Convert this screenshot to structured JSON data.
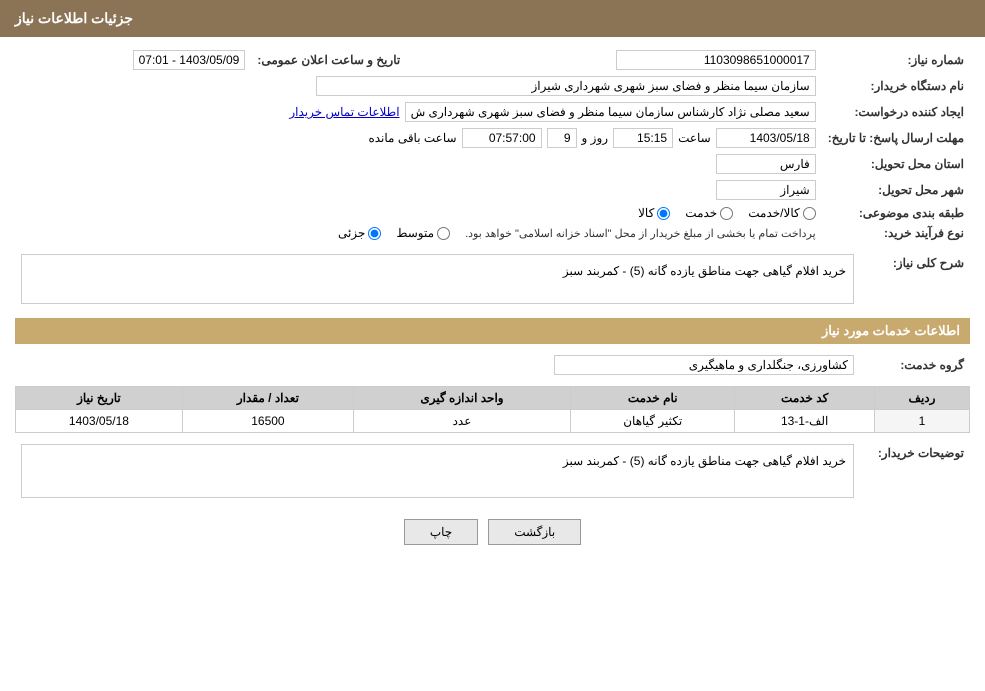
{
  "header": {
    "title": "جزئیات اطلاعات نیاز"
  },
  "info": {
    "need_number_label": "شماره نیاز:",
    "need_number_value": "1103098651000017",
    "announcement_date_label": "تاریخ و ساعت اعلان عمومی:",
    "announcement_date_value": "1403/05/09 - 07:01",
    "buyer_org_label": "نام دستگاه خریدار:",
    "buyer_org_value": "سازمان سیما منظر و فضای سبز شهری شهرداری شیراز",
    "creator_label": "ایجاد کننده درخواست:",
    "creator_value": "سعید مصلی نژاد کارشناس سازمان سیما منظر و فضای سبز شهری شهرداری ش",
    "contact_link": "اطلاعات تماس خریدار",
    "deadline_label": "مهلت ارسال پاسخ: تا تاریخ:",
    "deadline_date_value": "1403/05/18",
    "deadline_time_label": "ساعت",
    "deadline_time_value": "15:15",
    "deadline_days_label": "روز و",
    "deadline_days_value": "9",
    "deadline_remaining_label": "ساعت باقی مانده",
    "deadline_remaining_value": "07:57:00",
    "province_label": "استان محل تحویل:",
    "province_value": "فارس",
    "city_label": "شهر محل تحویل:",
    "city_value": "شیراز",
    "category_label": "طبقه بندی موضوعی:",
    "category_options": [
      "کالا",
      "خدمت",
      "کالا/خدمت"
    ],
    "category_selected": "کالا",
    "process_label": "نوع فرآیند خرید:",
    "process_options": [
      "جزئی",
      "متوسط"
    ],
    "process_note": "پرداخت تمام یا بخشی از مبلغ خریدار از محل \"اسناد خزانه اسلامی\" خواهد بود.",
    "need_desc_label": "شرح کلی نیاز:",
    "need_desc_value": "خرید افلام گیاهی جهت مناطق یازده گانه (5) - کمربند سبز",
    "services_section_title": "اطلاعات خدمات مورد نیاز",
    "service_group_label": "گروه خدمت:",
    "service_group_value": "کشاورزی، جنگلداری و ماهیگیری",
    "table_headers": [
      "ردیف",
      "کد خدمت",
      "نام خدمت",
      "واحد اندازه گیری",
      "تعداد / مقدار",
      "تاریخ نیاز"
    ],
    "table_rows": [
      {
        "row": "1",
        "service_code": "الف-1-13",
        "service_name": "تکثیر گیاهان",
        "unit": "عدد",
        "quantity": "16500",
        "date": "1403/05/18"
      }
    ],
    "buyer_notes_label": "توضیحات خریدار:",
    "buyer_notes_value": "خرید افلام گیاهی جهت مناطق یازده گانه (5) - کمربند سبز",
    "btn_print": "چاپ",
    "btn_back": "بازگشت"
  }
}
